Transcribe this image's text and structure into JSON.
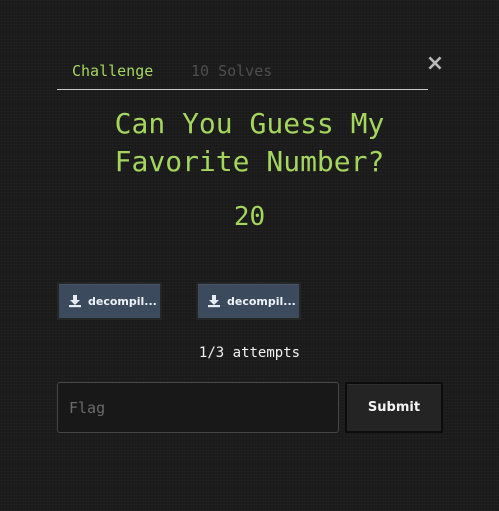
{
  "modal": {
    "close_label": "×",
    "tabs": [
      {
        "label": "Challenge",
        "active": true
      },
      {
        "label": "10 Solves",
        "active": false
      }
    ],
    "title_lines": [
      "Can You Guess My",
      "Favorite Number?"
    ],
    "points": "20",
    "files": [
      {
        "label": "decompil...",
        "icon": "download-icon"
      },
      {
        "label": "decompil...",
        "icon": "download-icon"
      }
    ],
    "attempts": "1/3 attempts",
    "flag_input": {
      "value": "",
      "placeholder": "Flag"
    },
    "submit_label": "Submit"
  },
  "colors": {
    "accent": "#a4d65e",
    "background": "#1c1c1c",
    "file_button": "#3c4a5e",
    "submit_button": "#242424",
    "inactive_tab": "#4e4e4e"
  }
}
